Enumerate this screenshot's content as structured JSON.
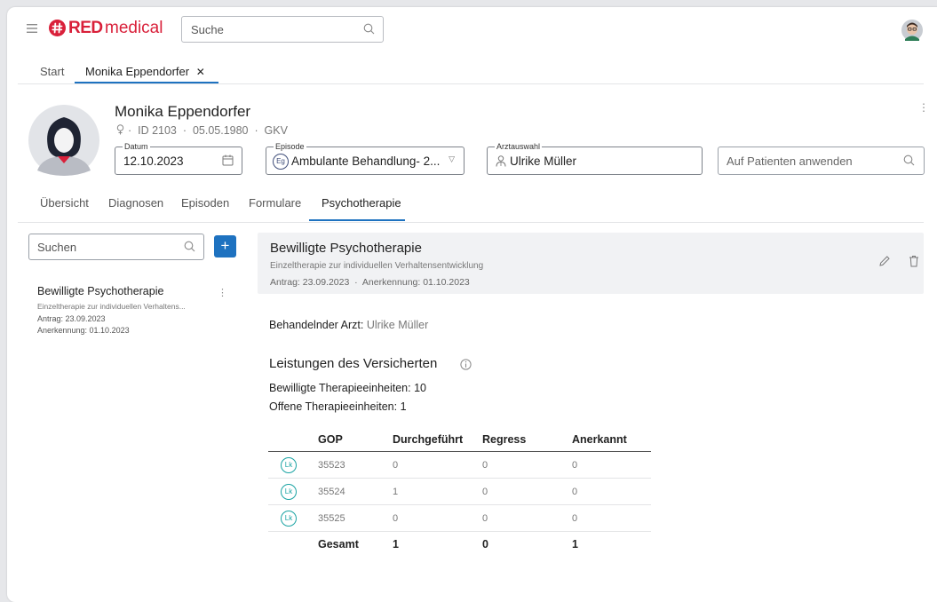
{
  "header": {
    "brand": "RED",
    "brand_suffix": "medical",
    "search_placeholder": "Suche"
  },
  "nav_tabs": [
    {
      "label": "Start"
    },
    {
      "label": "Monika Eppendorfer",
      "close": "✕"
    }
  ],
  "patient": {
    "name": "Monika Eppendorfer",
    "meta": "·  ID 2103  ·  05.05.1980  ·  GKV",
    "datum_label": "Datum",
    "datum_value": "12.10.2023",
    "episode_label": "Episode",
    "episode_badge": "Eg",
    "episode_value": "Ambulante Behandlung- 2...",
    "arzt_label": "Arztauswahl",
    "arzt_value": "Ulrike Müller",
    "apply_placeholder": "Auf Patienten anwenden"
  },
  "section_tabs": [
    {
      "label": "Übersicht"
    },
    {
      "label": "Diagnosen"
    },
    {
      "label": "Episoden"
    },
    {
      "label": "Formulare"
    },
    {
      "label": "Psychotherapie",
      "active": true
    }
  ],
  "sidebar": {
    "search_placeholder": "Suchen",
    "add_label": "+",
    "item": {
      "title": "Bewilligte Psychotherapie",
      "subtitle": "Einzeltherapie zur individuellen Verhaltens...",
      "antrag": "Antrag: 23.09.2023",
      "anerkennung": "Anerkennung: 01.10.2023"
    }
  },
  "detail": {
    "title": "Bewilligte Psychotherapie",
    "subtitle": "Einzeltherapie zur individuellen Verhaltensentwicklung",
    "dates": "Antrag: 23.09.2023  ·  Anerkennung: 01.10.2023",
    "arzt_label": "Behandelnder Arzt:",
    "arzt_value": "Ulrike Müller",
    "leistungen_title": "Leistungen des Versicherten",
    "bewilligt": "Bewilligte Therapieeinheiten: 10",
    "offen": "Offene Therapieeinheiten: 1"
  },
  "table": {
    "headers": [
      "GOP",
      "Durchgeführt",
      "Regress",
      "Anerkannt"
    ],
    "badge": "Lk",
    "rows": [
      [
        "35523",
        "0",
        "0",
        "0"
      ],
      [
        "35524",
        "1",
        "0",
        "0"
      ],
      [
        "35525",
        "0",
        "0",
        "0"
      ]
    ],
    "total": [
      "Gesamt",
      "1",
      "0",
      "1"
    ]
  },
  "colors": {
    "brand_red": "#d9203a",
    "accent_blue": "#1e72c0",
    "lk_teal": "#1aa3a3"
  }
}
